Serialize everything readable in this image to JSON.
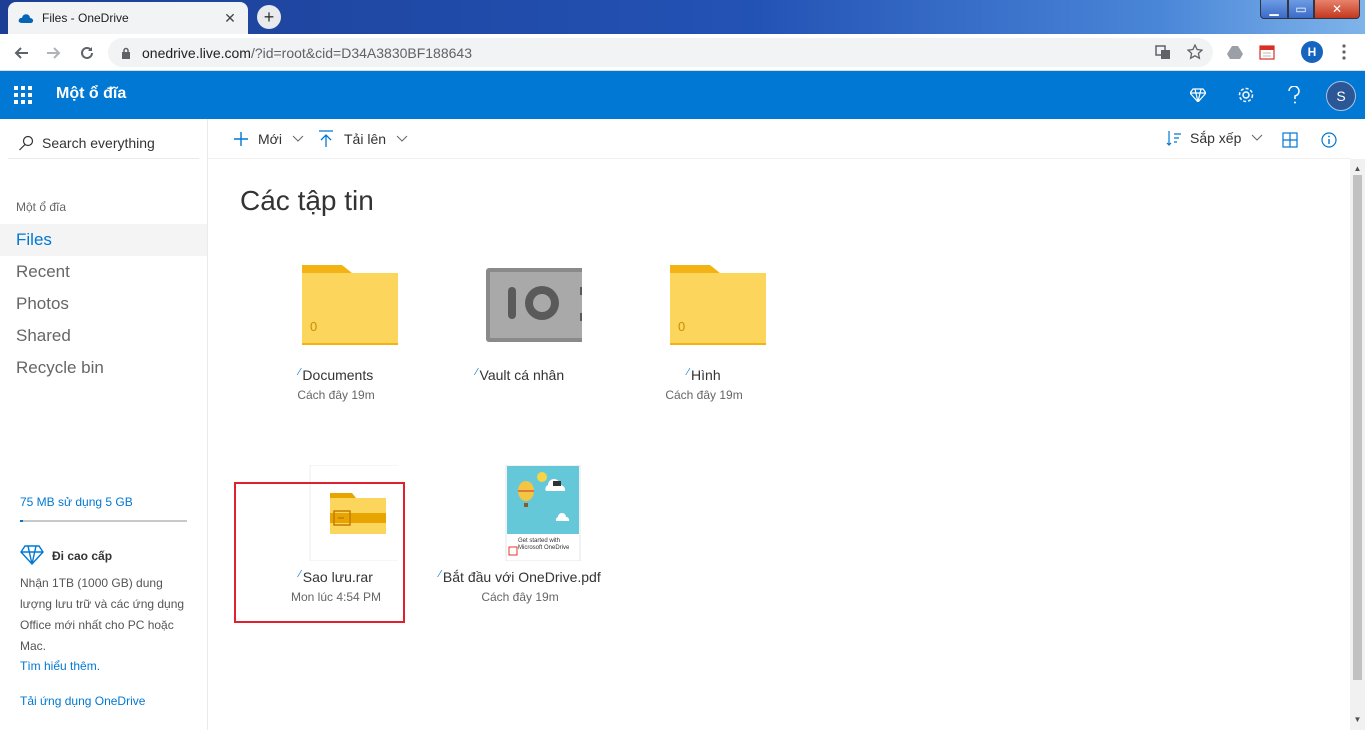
{
  "browser": {
    "tab_title": "Files - OneDrive",
    "tab_close": "✕",
    "new_tab": "+",
    "url_host": "onedrive.live.com",
    "url_rest": "/?id=root&cid=D34A3830BF188643",
    "profile_initial": "H",
    "window_controls": {
      "minimize": "▁",
      "maximize": "▭",
      "close": "✕"
    }
  },
  "header": {
    "app_name": "Một ổ đĩa",
    "avatar_initial": "S",
    "brand_color": "#0078d4"
  },
  "sidebar": {
    "search_placeholder": "Search everything",
    "heading": "Một ổ đĩa",
    "items": [
      {
        "label": "Files",
        "active": true
      },
      {
        "label": "Recent"
      },
      {
        "label": "Photos"
      },
      {
        "label": "Shared"
      },
      {
        "label": "Recycle bin"
      }
    ],
    "storage_text": "75 MB sử dụng 5 GB",
    "storage_used_fraction": 0.015,
    "premium_title": "Đi cao cấp",
    "premium_desc": "Nhận 1TB (1000 GB) dung lượng lưu trữ và các ứng dụng Office mới nhất cho PC hoặc Mac.",
    "learn_more": "Tìm hiểu thêm.",
    "get_app": "Tải ứng dụng OneDrive"
  },
  "commands": {
    "new_label": "Mới",
    "upload_label": "Tải lên",
    "sort_label": "Sắp xếp"
  },
  "main": {
    "title": "Các tập tin",
    "items": [
      {
        "name": "Documents",
        "date": "Cách đây 19m",
        "type": "folder",
        "count": "0"
      },
      {
        "name": "Vault cá nhân",
        "date": "",
        "type": "vault"
      },
      {
        "name": "Hình",
        "date": "Cách đây 19m",
        "type": "folder",
        "count": "0"
      },
      {
        "name": "Sao lưu.rar",
        "date": "Mon lúc 4:54 PM",
        "type": "archive"
      },
      {
        "name": "Bắt đầu với OneDrive.pdf",
        "date": "Cách đây 19m",
        "type": "pdf",
        "thumb_caption": "Get started with Microsoft OneDrive"
      }
    ]
  }
}
